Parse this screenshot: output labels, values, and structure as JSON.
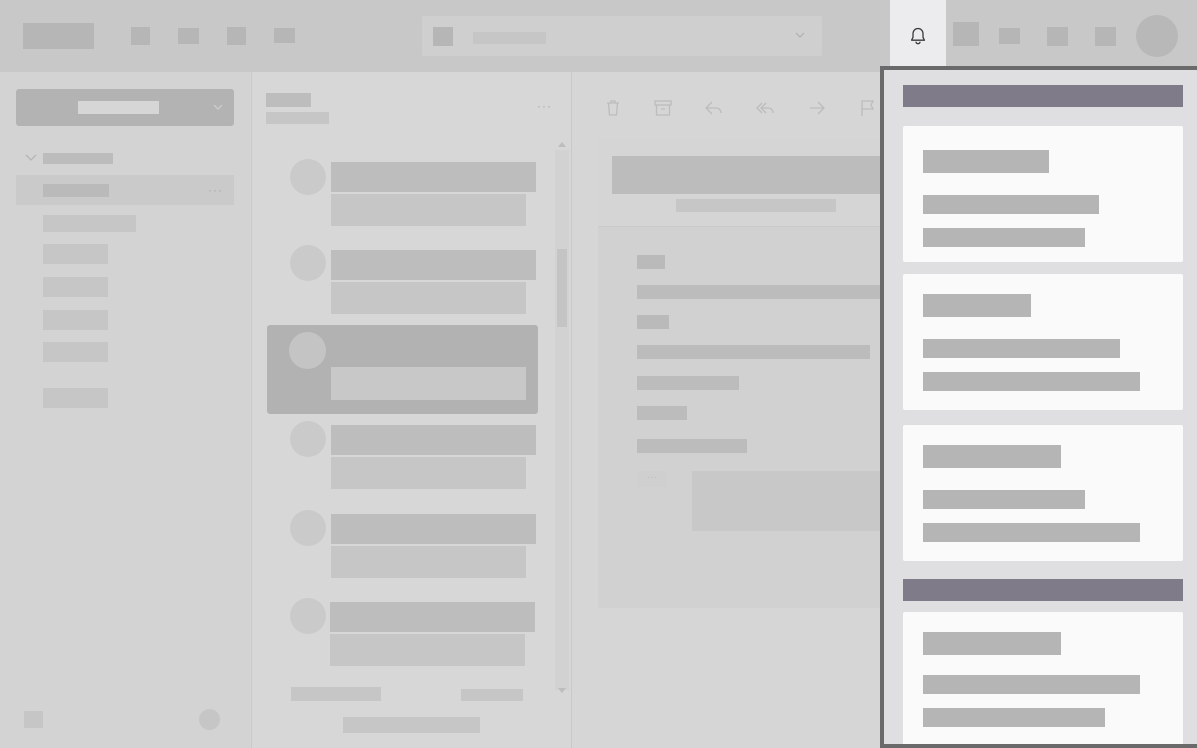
{
  "notifications": {
    "button_icon": "bell-icon",
    "sections": [
      {
        "cards": 3
      },
      {
        "cards": 1
      }
    ]
  },
  "toolbar_icons": [
    "trash-icon",
    "archive-icon",
    "reply-icon",
    "reply-all-icon",
    "forward-icon",
    "flag-icon"
  ],
  "search": {
    "icon": "search-icon",
    "chevron": "chevron-down-icon"
  }
}
